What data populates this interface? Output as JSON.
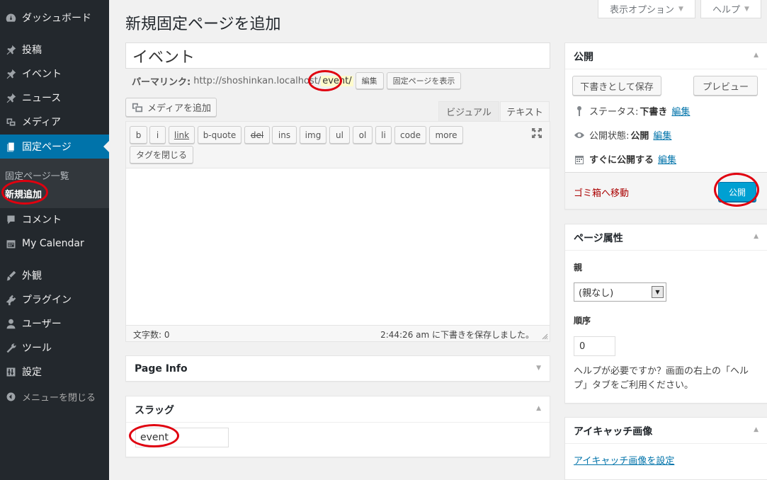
{
  "sidebar": {
    "items": [
      {
        "label": "ダッシュボード",
        "icon": "dashboard-icon"
      },
      {
        "label": "投稿",
        "icon": "pin-icon"
      },
      {
        "label": "イベント",
        "icon": "pin-icon"
      },
      {
        "label": "ニュース",
        "icon": "pin-icon"
      },
      {
        "label": "メディア",
        "icon": "media-icon"
      },
      {
        "label": "固定ページ",
        "icon": "pages-icon"
      },
      {
        "label": "コメント",
        "icon": "comment-icon"
      },
      {
        "label": "My Calendar",
        "icon": "calendar-icon"
      },
      {
        "label": "外観",
        "icon": "brush-icon"
      },
      {
        "label": "プラグイン",
        "icon": "plugin-icon"
      },
      {
        "label": "ユーザー",
        "icon": "user-icon"
      },
      {
        "label": "ツール",
        "icon": "wrench-icon"
      },
      {
        "label": "設定",
        "icon": "settings-icon"
      }
    ],
    "submenu": [
      "固定ページ一覧",
      "新規追加"
    ],
    "collapse_label": "メニューを閉じる"
  },
  "top": {
    "screen_options": "表示オプション",
    "help": "ヘルプ"
  },
  "page_title": "新規固定ページを追加",
  "title_value": "イベント",
  "permalink": {
    "label": "パーマリンク:",
    "base": "http://shoshinkan.localhost/",
    "slug": "event/",
    "edit_button": "編集",
    "view_button": "固定ページを表示"
  },
  "editor": {
    "add_media": "メディアを追加",
    "tab_visual": "ビジュアル",
    "tab_text": "テキスト",
    "quicktags": [
      "b",
      "i",
      "link",
      "b-quote",
      "del",
      "ins",
      "img",
      "ul",
      "ol",
      "li",
      "code",
      "more"
    ],
    "close_tags": "タグを閉じる",
    "word_count": "文字数: 0",
    "autosave": "2:44:26 am に下書きを保存しました。"
  },
  "page_info": {
    "title": "Page Info"
  },
  "slug_box": {
    "title": "スラッグ",
    "value": "event"
  },
  "publish": {
    "title": "公開",
    "save_draft": "下書きとして保存",
    "preview": "プレビュー",
    "status_label": "ステータス:",
    "status_value": "下書き",
    "visibility_label": "公開状態:",
    "visibility_value": "公開",
    "schedule_label": "すぐに公開する",
    "edit": "編集",
    "trash": "ゴミ箱へ移動",
    "publish_button": "公開"
  },
  "page_attributes": {
    "title": "ページ属性",
    "parent_label": "親",
    "parent_value": "(親なし)",
    "order_label": "順序",
    "order_value": "0",
    "help_text": "ヘルプが必要ですか？画面の右上の「ヘルプ」タブをご利用ください。"
  },
  "featured_image": {
    "title": "アイキャッチ画像",
    "link": "アイキャッチ画像を設定"
  },
  "colors": {
    "sidebar_bg": "#23282d",
    "accent": "#0073aa",
    "publish_btn": "#00a0d2",
    "annotation_red": "#e0000f"
  }
}
